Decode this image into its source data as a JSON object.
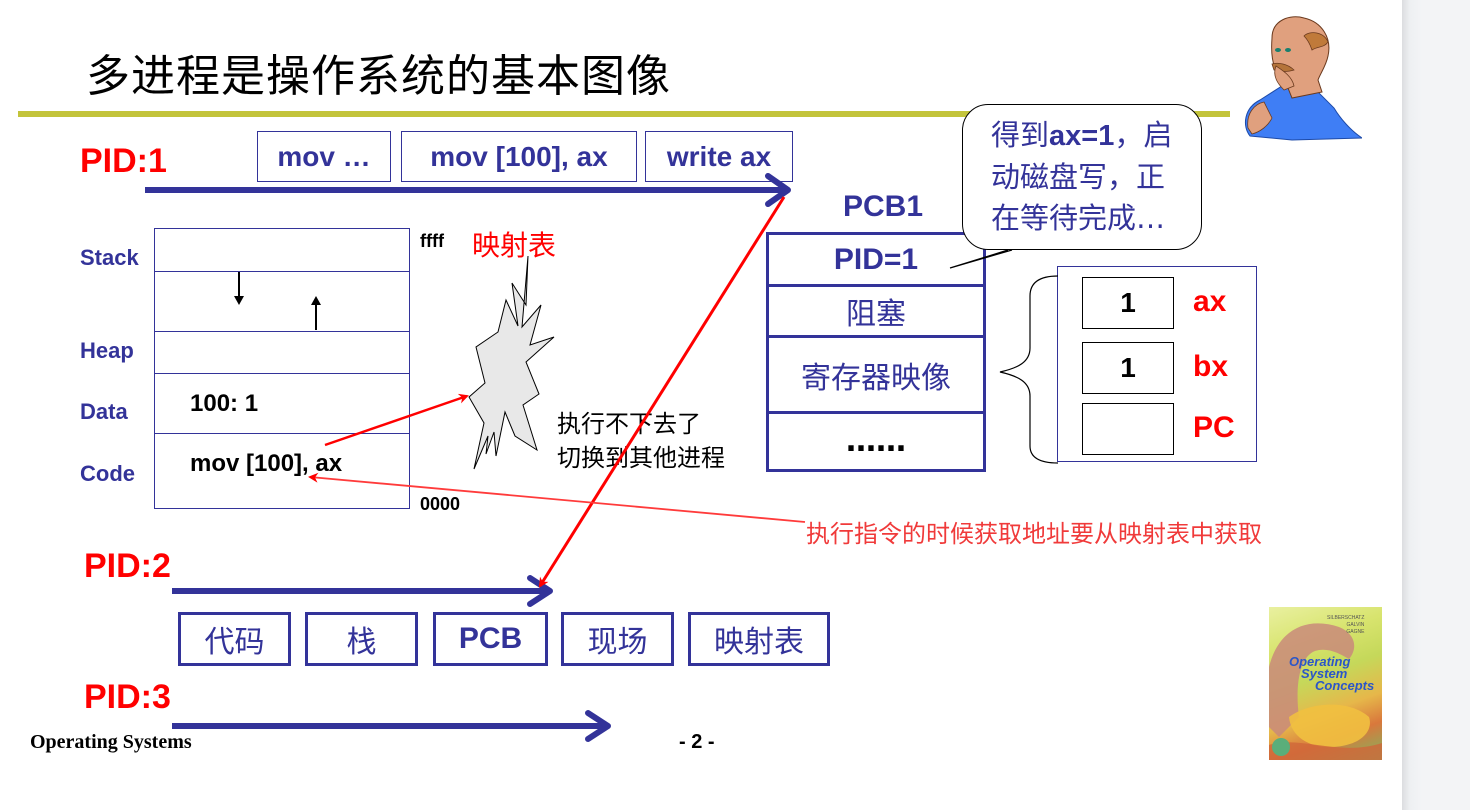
{
  "slide": {
    "title": "多进程是操作系统的基本图像",
    "footer_left": "Operating Systems",
    "page_number": "- 2 -"
  },
  "colors": {
    "accent_rule": "#c3c43b",
    "pid_red": "#ff0000",
    "navy": "#333399"
  },
  "process1": {
    "label": "PID:1",
    "instructions": [
      "mov …",
      "mov [100], ax",
      "write ax"
    ]
  },
  "memory": {
    "segment_labels": [
      "Stack",
      "Heap",
      "Data",
      "Code"
    ],
    "data_value": "100:  1",
    "code_value": "mov [100], ax",
    "addr_top": "ffff",
    "addr_bottom": "0000",
    "map_table_label": "映射表",
    "stuck_note_line1": "执行不下去了",
    "stuck_note_line2": "切换到其他进程",
    "fetch_note": "执行指令的时候获取地址要从映射表中获取"
  },
  "pcb": {
    "title": "PCB1",
    "rows": [
      "PID=1",
      "阻塞",
      "寄存器映像",
      "……"
    ],
    "bubble_line1_prefix": "得到",
    "bubble_line1_bold": "ax=1",
    "bubble_line1_suffix": "，启",
    "bubble_line2": "动磁盘写，正",
    "bubble_line3": "在等待完成…"
  },
  "registers": [
    {
      "name": "ax",
      "value": "1"
    },
    {
      "name": "bx",
      "value": "1"
    },
    {
      "name": "PC",
      "value": ""
    }
  ],
  "process2": {
    "label": "PID:2",
    "resources": [
      "代码",
      "栈",
      "PCB",
      "现场",
      "映射表"
    ]
  },
  "process3": {
    "label": "PID:3"
  },
  "book": {
    "title_line1": "Operating",
    "title_line2": "System",
    "title_line3": "Concepts",
    "authors": [
      "SILBERSCHATZ",
      "GALVIN",
      "GAGNE"
    ]
  }
}
